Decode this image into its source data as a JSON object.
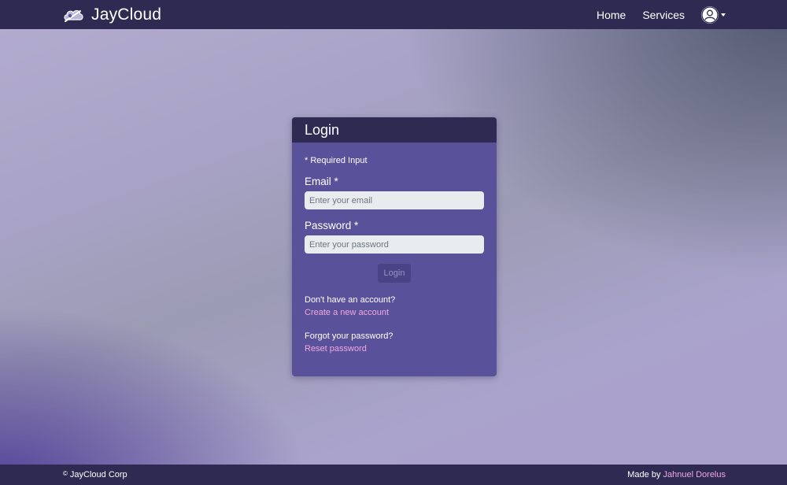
{
  "navbar": {
    "brand": "JayCloud",
    "links": [
      "Home",
      "Services"
    ]
  },
  "login": {
    "title": "Login",
    "required_note": "* Required Input",
    "email": {
      "label": "Email *",
      "placeholder": "Enter your email",
      "value": ""
    },
    "password": {
      "label": "Password *",
      "placeholder": "Enter your password",
      "value": ""
    },
    "submit_label": "Login",
    "signup_prompt": "Don't have an account?",
    "signup_link": "Create a new account",
    "forgot_prompt": "Forgot your password?",
    "reset_link": "Reset password"
  },
  "footer": {
    "copyright_symbol": "©",
    "company": "JayCloud Corp",
    "made_by_prefix": "Made by",
    "author": "Jahnuel Dorelus"
  },
  "colors": {
    "navbar_bg": "#2e2a52",
    "card_bg": "#5a519b",
    "link": "#f0a8e0",
    "button_bg": "#4a4386"
  },
  "icons": {
    "brand": "cloud-logo-icon",
    "user": "user-avatar-icon",
    "menu": "caret-down-icon"
  }
}
